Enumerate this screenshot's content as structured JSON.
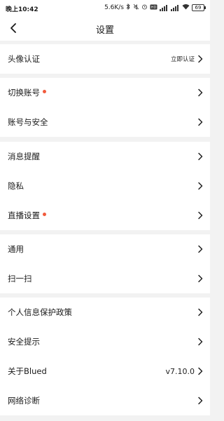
{
  "status_bar": {
    "time": "晚上10:42",
    "net_speed": "5.6K/s",
    "battery": "69"
  },
  "header": {
    "title": "设置"
  },
  "groups": [
    {
      "items": [
        {
          "label": "头像认证",
          "value": "立即认证",
          "dot": false
        }
      ]
    },
    {
      "items": [
        {
          "label": "切换账号",
          "dot": true
        },
        {
          "label": "账号与安全",
          "dot": false
        }
      ]
    },
    {
      "items": [
        {
          "label": "消息提醒",
          "dot": false
        },
        {
          "label": "隐私",
          "dot": false
        },
        {
          "label": "直播设置",
          "dot": true
        }
      ]
    },
    {
      "items": [
        {
          "label": "通用",
          "dot": false
        },
        {
          "label": "扫一扫",
          "dot": false
        }
      ]
    },
    {
      "items": [
        {
          "label": "个人信息保护政策",
          "dot": false
        },
        {
          "label": "安全提示",
          "dot": false
        },
        {
          "label": "关于Blued",
          "value": "v7.10.0",
          "dot": false
        },
        {
          "label": "网络诊断",
          "dot": false
        }
      ]
    }
  ],
  "colors": {
    "dot": "#f15a3c",
    "background": "#f2f2f2"
  }
}
